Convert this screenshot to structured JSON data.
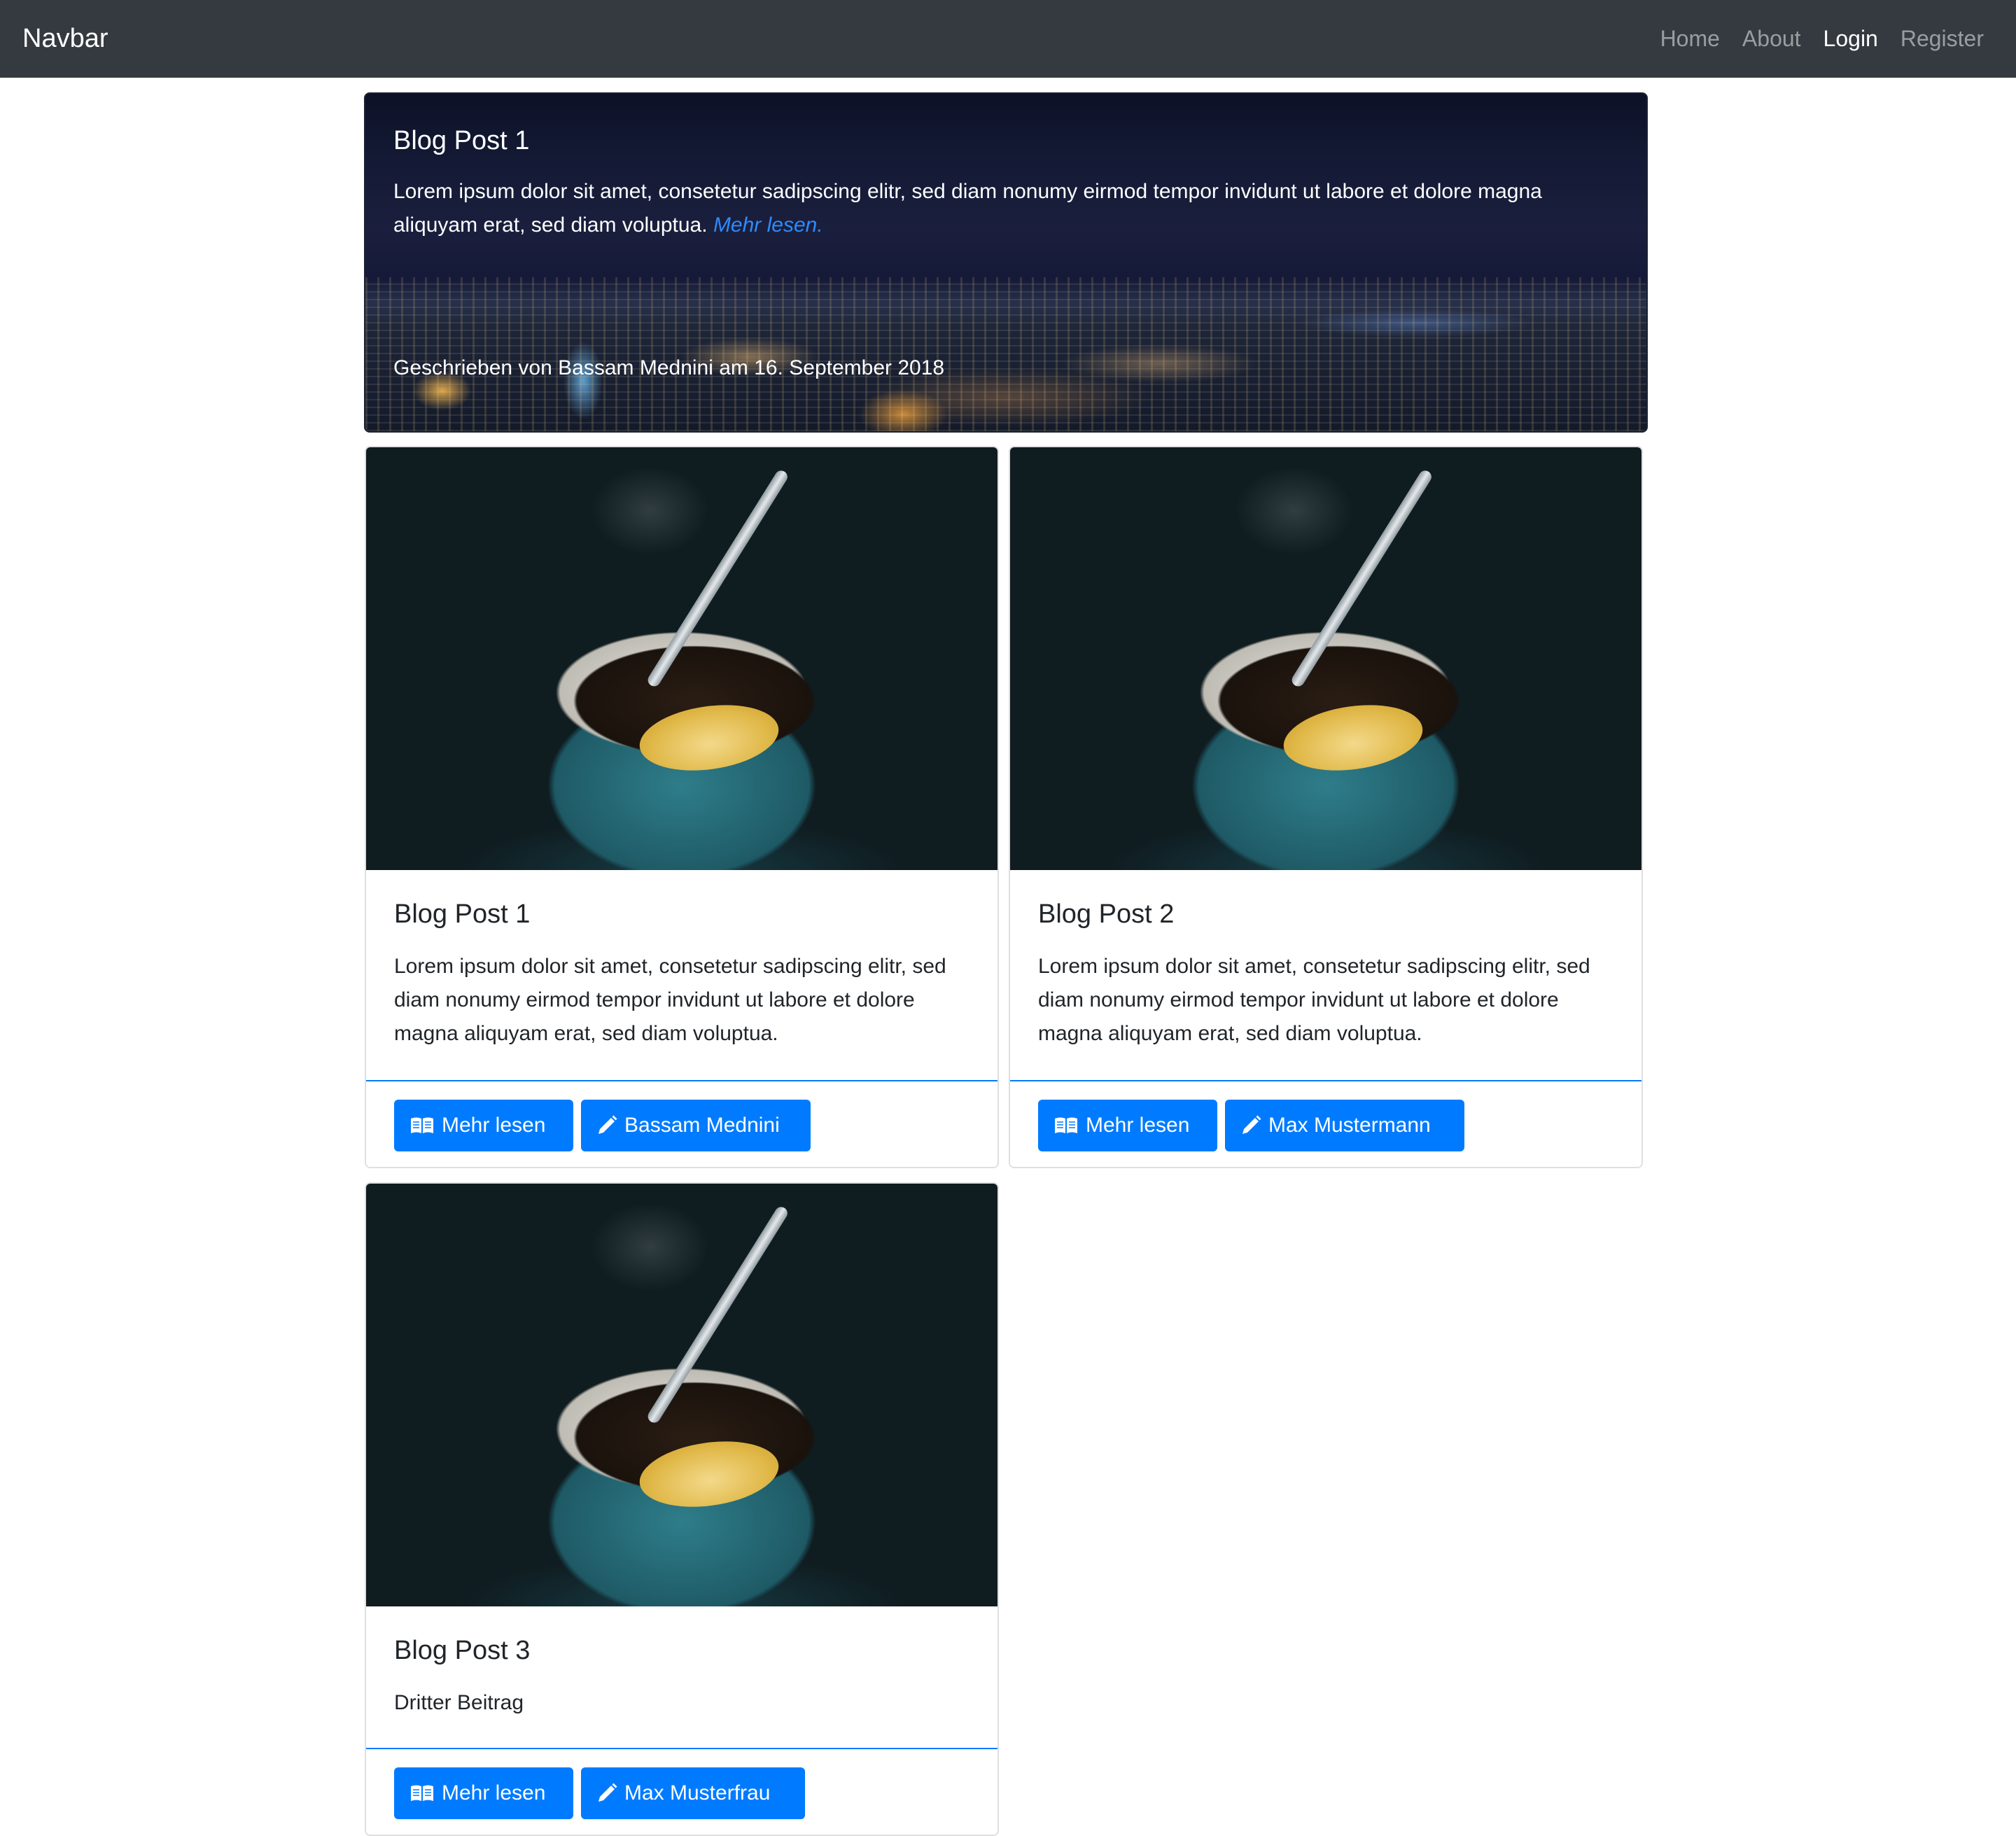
{
  "navbar": {
    "brand": "Navbar",
    "links": [
      "Home",
      "About",
      "Login",
      "Register"
    ],
    "active": "Login",
    "bg_color": "#343a40"
  },
  "jumbotron": {
    "title": "Blog Post 1",
    "text": "Lorem ipsum dolor sit amet, consetetur sadipscing elitr, sed diam nonumy eirmod tempor invidunt ut labore et dolore magna aliquyam erat, sed diam voluptua.",
    "link_label": "Mehr lesen.",
    "meta": "Geschrieben von Bassam Mednini am 16. September 2018"
  },
  "posts": [
    {
      "title": "Blog Post 1",
      "text": "Lorem ipsum dolor sit amet, consetetur sadipscing elitr, sed diam nonumy eirmod tempor invidunt ut labore et dolore magna aliquyam erat, sed diam voluptua.",
      "read_label": "Mehr lesen",
      "author_label": "Bassam Mednini"
    },
    {
      "title": "Blog Post 2",
      "text": "Lorem ipsum dolor sit amet, consetetur sadipscing elitr, sed diam nonumy eirmod tempor invidunt ut labore et dolore magna aliquyam erat, sed diam voluptua.",
      "read_label": "Mehr lesen",
      "author_label": "Max Mustermann"
    },
    {
      "title": "Blog Post 3",
      "text": "Dritter Beitrag",
      "read_label": "Mehr lesen",
      "author_label": "Max Musterfrau"
    }
  ],
  "icons": {
    "read": "book-open-icon",
    "author": "pencil-icon"
  },
  "colors": {
    "primary": "#007bff",
    "link": "#2d8bff"
  }
}
